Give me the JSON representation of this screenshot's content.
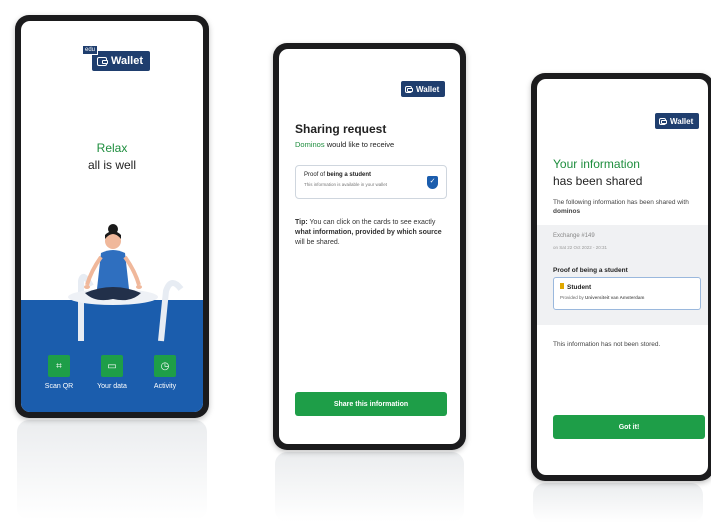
{
  "phone1": {
    "edu_tag": "edu",
    "wallet_label": "Wallet",
    "relax": "Relax",
    "all_well": "all is well",
    "nav": [
      {
        "label": "Scan QR",
        "icon": "qr-scan-icon"
      },
      {
        "label": "Your data",
        "icon": "wallet-icon"
      },
      {
        "label": "Activity",
        "icon": "clock-icon"
      }
    ]
  },
  "phone2": {
    "wallet_label": "Wallet",
    "title": "Sharing request",
    "requester": "Dominos",
    "request_text": "would like to receive",
    "card_prefix": "Proof of",
    "card_bold": "being a student",
    "card_sub": "This information is available in your wallet",
    "tip_label": "Tip:",
    "tip_text_1": "You can click on the cards to see exactly",
    "tip_bold_1": "what information, provided by which source",
    "tip_text_2": "will be shared.",
    "share_button": "Share this information"
  },
  "phone3": {
    "wallet_label": "Wallet",
    "title_green": "Your information",
    "title_black": "has been shared",
    "shared_text": "The following information has been shared with",
    "shared_with": "dominos",
    "exchange": "Exchange #149",
    "exchange_date": "on Sat 22 Oct 2022 - 20:31",
    "proof_label": "Proof of being a student",
    "card_title": "Student",
    "card_sub_prefix": "Provided by",
    "card_sub_bold": "Universiteit van Amsterdam",
    "not_stored": "This information has not been stored.",
    "gotit_button": "Got it!"
  },
  "colors": {
    "brand_blue": "#1f3e6e",
    "green": "#1e9e48",
    "nav_blue": "#1b5dad"
  }
}
